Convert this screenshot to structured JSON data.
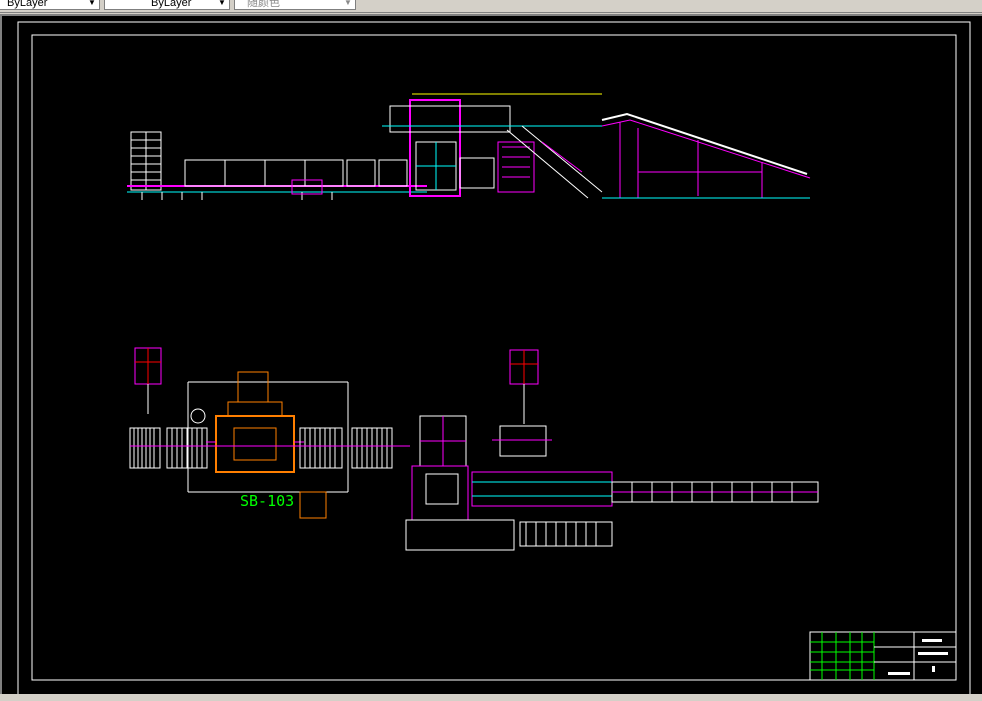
{
  "toolbar": {
    "linetype_value": "ByLayer",
    "lineweight_value": "ByLayer",
    "plotstyle_value": "随颜色"
  },
  "drawing": {
    "equipment_label": "SB-103"
  },
  "colors": {
    "background": "#000000",
    "frame": "#ffffff",
    "magenta": "#ff00ff",
    "cyan": "#00ffff",
    "orange": "#ff7f00",
    "green": "#00ff00",
    "red": "#ff0000",
    "yellow": "#ffff00"
  }
}
